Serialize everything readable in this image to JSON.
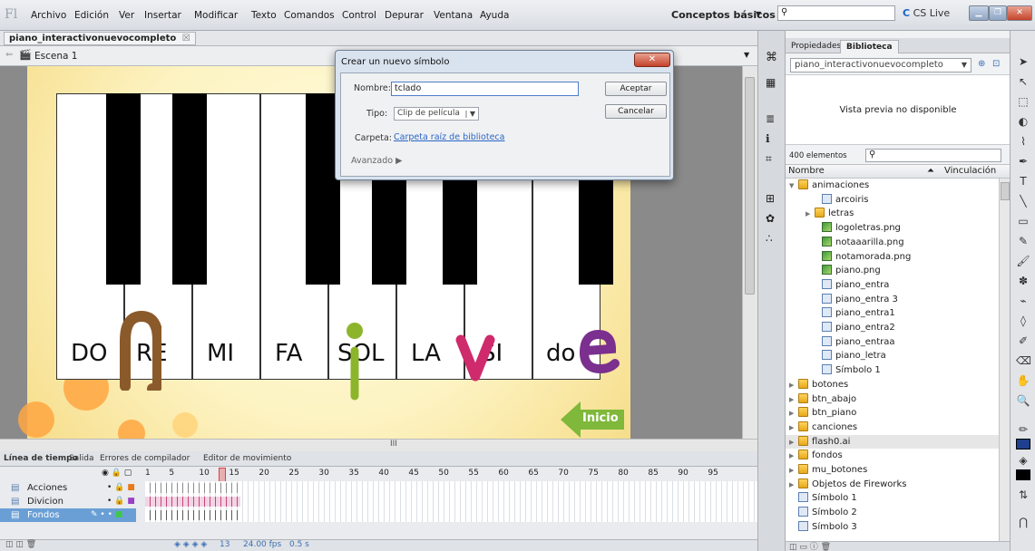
{
  "menubar": {
    "logo": "Fl",
    "items": [
      "Archivo",
      "Edición",
      "Ver",
      "Insertar",
      "Modificar",
      "Texto",
      "Comandos",
      "Control",
      "Depurar",
      "Ventana",
      "Ayuda"
    ],
    "workspace": "Conceptos básicos",
    "cs_live": "CS Live"
  },
  "document": {
    "tab_name": "piano_interactivonuevocompleto",
    "scene": "Escena 1"
  },
  "stage": {
    "notes": [
      "DO",
      "RE",
      "MI",
      "FA",
      "SOL",
      "LA",
      "SI",
      "do"
    ],
    "home_button": "Inicio"
  },
  "timeline": {
    "tabs": [
      "Línea de tiempo",
      "Salida",
      "Errores de compilador",
      "Editor de movimiento"
    ],
    "frame_numbers": [
      "1",
      "5",
      "10",
      "15",
      "20",
      "25",
      "30",
      "35",
      "40",
      "45",
      "50",
      "55",
      "60",
      "65",
      "70",
      "75",
      "80",
      "85",
      "90",
      "95"
    ],
    "layers": [
      "Acciones",
      "Divicion",
      "Fondos"
    ],
    "current_frame": "13",
    "fps": "24.00 fps",
    "time": "0.5 s"
  },
  "library": {
    "tabs": [
      "Propiedades",
      "Biblioteca"
    ],
    "file": "piano_interactivonuevocompleto",
    "preview_text": "Vista previa no disponible",
    "count": "400 elementos",
    "col_name": "Nombre",
    "col_link": "Vinculación",
    "items": [
      {
        "label": "animaciones",
        "type": "folder",
        "depth": 0,
        "open": true
      },
      {
        "label": "arcoiris",
        "type": "mc",
        "depth": 2
      },
      {
        "label": "letras",
        "type": "folder",
        "depth": 1
      },
      {
        "label": "logoletras.png",
        "type": "bmp",
        "depth": 2
      },
      {
        "label": "notaaarilla.png",
        "type": "bmp",
        "depth": 2
      },
      {
        "label": "notamorada.png",
        "type": "bmp",
        "depth": 2
      },
      {
        "label": "piano.png",
        "type": "bmp",
        "depth": 2
      },
      {
        "label": "piano_entra",
        "type": "mc",
        "depth": 2
      },
      {
        "label": "piano_entra 3",
        "type": "mc",
        "depth": 2
      },
      {
        "label": "piano_entra1",
        "type": "mc",
        "depth": 2
      },
      {
        "label": "piano_entra2",
        "type": "mc",
        "depth": 2
      },
      {
        "label": "piano_entraa",
        "type": "mc",
        "depth": 2
      },
      {
        "label": "piano_letra",
        "type": "mc",
        "depth": 2
      },
      {
        "label": "Símbolo 1",
        "type": "mc",
        "depth": 2
      },
      {
        "label": "botones",
        "type": "folder",
        "depth": 0
      },
      {
        "label": "btn_abajo",
        "type": "folder",
        "depth": 0
      },
      {
        "label": "btn_piano",
        "type": "folder",
        "depth": 0
      },
      {
        "label": "canciones",
        "type": "folder",
        "depth": 0
      },
      {
        "label": "flash0.ai",
        "type": "folder",
        "depth": 0,
        "selected": true
      },
      {
        "label": "fondos",
        "type": "folder",
        "depth": 0
      },
      {
        "label": "mu_botones",
        "type": "folder",
        "depth": 0
      },
      {
        "label": "Objetos de Fireworks",
        "type": "folder",
        "depth": 0
      },
      {
        "label": "Símbolo 1",
        "type": "mc",
        "depth": 0
      },
      {
        "label": "Símbolo 2",
        "type": "mc",
        "depth": 0
      },
      {
        "label": "Símbolo 3",
        "type": "mc",
        "depth": 0
      }
    ]
  },
  "dialog": {
    "title": "Crear un nuevo símbolo",
    "name_label": "Nombre:",
    "name_value": "tclado",
    "type_label": "Tipo:",
    "type_value": "Clip de película",
    "folder_label": "Carpeta:",
    "folder_value": "Carpeta raíz de biblioteca",
    "advanced": "Avanzado",
    "ok": "Aceptar",
    "cancel": "Cancelar"
  },
  "colors": {
    "accent_blue": "#2a66c4",
    "brown_letter": "#8b5a2b",
    "green_letter": "#8db52c",
    "pink_letter": "#cf2a6c",
    "purple_letter": "#7b2f8e",
    "inicio_green": "#7fb83a"
  }
}
